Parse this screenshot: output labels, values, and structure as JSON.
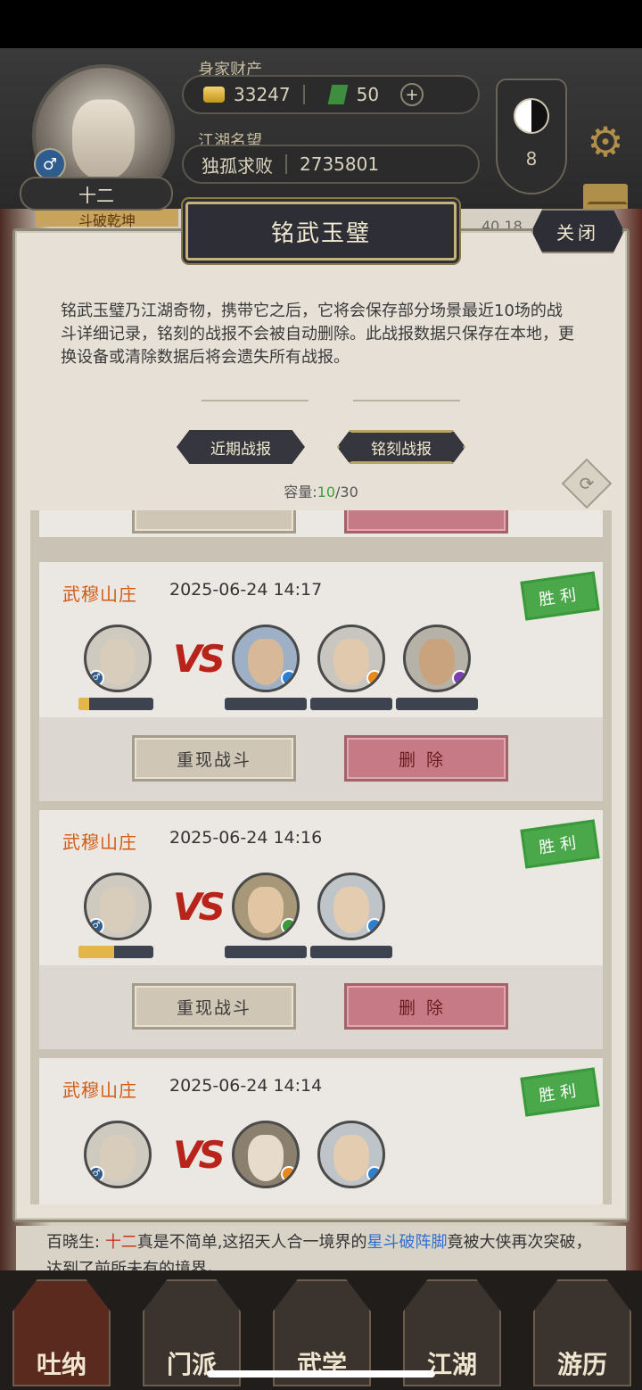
{
  "hud": {
    "player_name": "十二",
    "gender_symbol": "♂",
    "wealth_label": "身家财产",
    "gold": "33247",
    "jade": "50",
    "plus": "+",
    "fame_label": "江湖名望",
    "title": "独孤求败",
    "fame_value": "2735801",
    "level": "8",
    "behind_strip": "斗破乾坤",
    "behind_right": "40.18"
  },
  "modal": {
    "title": "铭武玉璧",
    "close_label": "关闭",
    "description": "铭武玉璧乃江湖奇物，携带它之后，它将会保存部分场景最近10场的战斗详细记录，铭刻的战报不会被自动删除。此战报数据只保存在本地，更换设备或清除数据后将会遗失所有战报。",
    "tab_recent": "近期战报",
    "tab_engraved": "铭刻战报",
    "capacity_label": "容量:",
    "capacity_current": "10",
    "capacity_sep_total": "/30"
  },
  "records": [
    {
      "location": "武穆山庄",
      "time": "2025-06-24 14:17",
      "result": "胜利",
      "vs": "VS",
      "player_hp": 0.14,
      "replay_label": "重现战斗",
      "delete_label": "删除"
    },
    {
      "location": "武穆山庄",
      "time": "2025-06-24 14:16",
      "result": "胜利",
      "vs": "VS",
      "player_hp": 0.48,
      "replay_label": "重现战斗",
      "delete_label": "删除"
    },
    {
      "location": "武穆山庄",
      "time": "2025-06-24 14:14",
      "result": "胜利",
      "vs": "VS"
    }
  ],
  "chat": {
    "speaker": "百晓生:",
    "name": "十二",
    "text1": "真是不简单,这招天人合一境界的",
    "skill": "星斗破阵脚",
    "text2": "竟被大侠再次突破，达到了前所未有的境界。"
  },
  "nav": [
    "吐纳",
    "门派",
    "武学",
    "江湖",
    "游历"
  ],
  "colors": {
    "location": "#d25a14",
    "win_green": "#4aa84a",
    "delete_pink": "#c67a86",
    "vs_red": "#b8241a"
  }
}
